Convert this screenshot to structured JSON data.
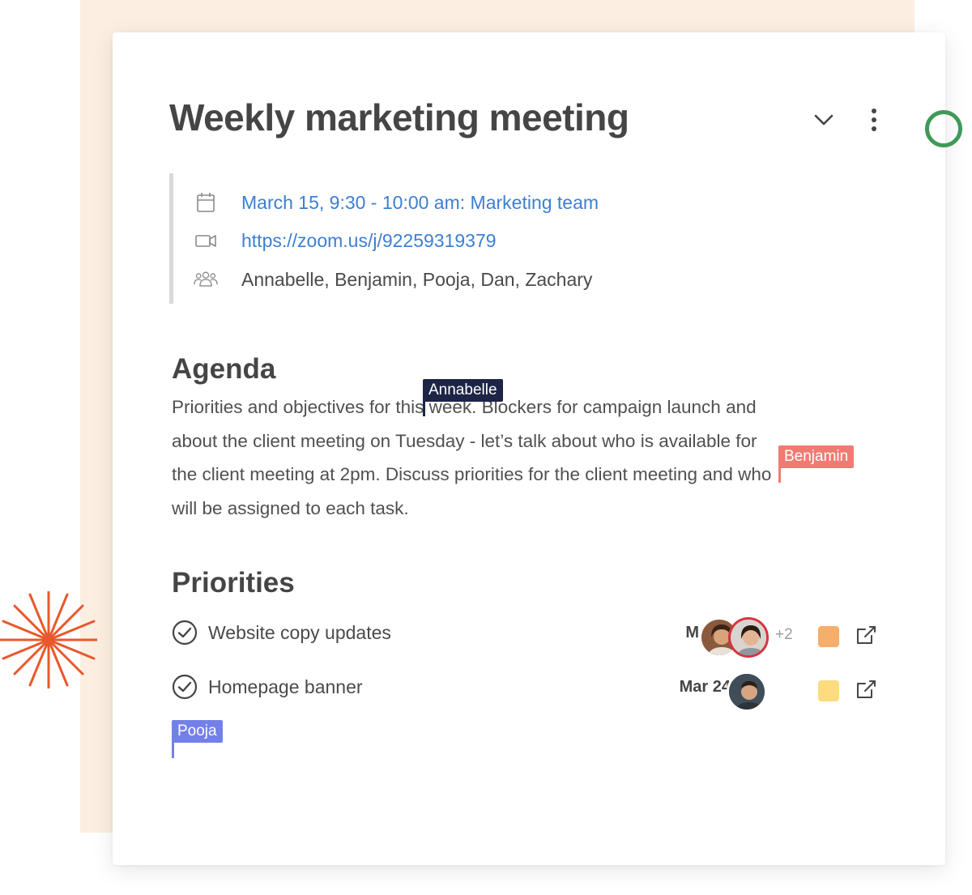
{
  "doc": {
    "title": "Weekly marketing meeting"
  },
  "meta": {
    "event": "March 15, 9:30 - 10:00 am: Marketing team",
    "link": "https://zoom.us/j/92259319379",
    "attendees": "Annabelle, Benjamin, Pooja, Dan, Zachary"
  },
  "agenda": {
    "heading": "Agenda",
    "lines": [
      "Priorities and objectives for this week. Blockers for campaign launch and",
      "about the client meeting on Tuesday - let’s talk about who is available for",
      "the client meeting at 2pm.  Discuss priorities for the client meeting and who",
      "will be assigned to each task."
    ]
  },
  "priorities": {
    "heading": "Priorities",
    "items": [
      {
        "label": "Website copy updates",
        "date": "May 1",
        "more": "+2",
        "color": "#f6ae6b"
      },
      {
        "label": "Homepage banner",
        "date": "Mar 24",
        "more": "",
        "color": "#fcdc7c"
      }
    ]
  },
  "collaborators": [
    {
      "name": "Annabelle",
      "color": "#1d2547"
    },
    {
      "name": "Benjamin",
      "color": "#f07b73"
    },
    {
      "name": "Pooja",
      "color": "#7480e9"
    }
  ],
  "icons": {
    "event": "calendar-icon",
    "link": "video-icon",
    "attendees": "people-icon",
    "collapse": "chevron-down-icon",
    "menu": "more-vertical-icon",
    "done": "check-circle-icon",
    "open": "external-link-icon"
  },
  "colors": {
    "background_panel": "#fcefe2",
    "link": "#3d7fd1",
    "accent_ring": "#3f9a5a",
    "burst": "#e8582c"
  }
}
